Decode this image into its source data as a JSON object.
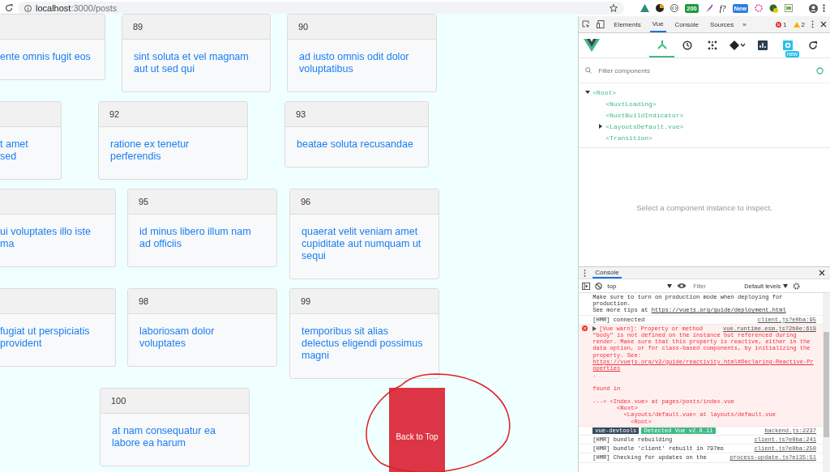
{
  "browser": {
    "host": "localhost",
    "path": ":3000/posts",
    "extensions": [
      {
        "kind": "triangle"
      },
      {
        "kind": "disc"
      },
      {
        "kind": "brackets"
      },
      {
        "kind": "badge",
        "label": "200",
        "color": "#1e9b3c"
      },
      {
        "kind": "feather"
      },
      {
        "kind": "glyph",
        "label": "f?"
      },
      {
        "kind": "badge",
        "label": "New",
        "color": "#2f7de1"
      },
      {
        "kind": "flower"
      },
      {
        "kind": "globe"
      },
      {
        "kind": "sheet"
      }
    ]
  },
  "posts": {
    "rows": [
      {
        "cards": [
          {
            "title": "ente omnis fugit eos"
          },
          {
            "number": "89",
            "title": "sint soluta et vel magnam aut ut sed qui"
          },
          {
            "number": "90",
            "title": "ad iusto omnis odit dolor voluptatibus"
          }
        ]
      },
      {
        "cards": [
          {
            "title": "t amet sed"
          },
          {
            "number": "92",
            "title": "ratione ex tenetur perferendis"
          },
          {
            "number": "93",
            "title": "beatae soluta recusandae"
          }
        ]
      },
      {
        "cards": [
          {
            "title": "ui voluptates illo iste ma"
          },
          {
            "number": "95",
            "title": "id minus libero illum nam ad officiis"
          },
          {
            "number": "96",
            "title": "quaerat velit veniam amet cupiditate aut numquam ut sequi"
          }
        ]
      },
      {
        "cards": [
          {
            "title": "fugiat ut perspiciatis provident"
          },
          {
            "number": "98",
            "title": "laboriosam dolor voluptates"
          },
          {
            "number": "99",
            "title": "temporibus sit alias delectus eligendi possimus magni"
          }
        ]
      },
      {
        "cards": [
          {
            "number": "100",
            "title": "at nam consequatur ea labore ea harum"
          }
        ]
      }
    ],
    "back_to_top": {
      "label": "Back to Top"
    }
  },
  "devtools": {
    "tabs": [
      {
        "label": "Elements",
        "selected": false
      },
      {
        "label": "Vue",
        "selected": true
      },
      {
        "label": "Console",
        "selected": false
      },
      {
        "label": "Sources",
        "selected": false
      }
    ],
    "more": "»",
    "errors": "1",
    "warnings": "2",
    "vue_tools": [
      {
        "kind": "components",
        "selected": true
      },
      {
        "kind": "history",
        "selected": false
      },
      {
        "kind": "vuex",
        "selected": false
      },
      {
        "kind": "routing",
        "selected": false
      },
      {
        "kind": "performance",
        "selected": false
      },
      {
        "kind": "settings",
        "selected": false,
        "badge": "new"
      },
      {
        "kind": "refresh",
        "selected": false
      }
    ],
    "filter": {
      "placeholder": "Filter components"
    },
    "tree": [
      {
        "name": "<Root>",
        "expanded": true,
        "children": [
          {
            "name": "<NuxtLoading>"
          },
          {
            "name": "<NuxtBuildIndicator>"
          },
          {
            "name": "<LayoutsDefault.vue>",
            "expanded": false
          },
          {
            "name": "<Transition>"
          }
        ]
      }
    ],
    "hint": "Select a component instance to inspect."
  },
  "console": {
    "tab": "Console",
    "context": "top",
    "filter": {
      "placeholder": "Filter"
    },
    "levels": "Default levels",
    "messages": [
      {
        "kind": "log",
        "text": "Make sure to turn on production mode when deploying for production.\nSee more tips at ",
        "link": "https://vuejs.org/guide/deployment.html"
      },
      {
        "kind": "log",
        "text": "[HMR] connected",
        "source": "client.js?e0ba:95"
      },
      {
        "kind": "error",
        "head": "[Vue warn]: Property or method",
        "text": "\"body\" is not defined on the instance but referenced during render. Make sure that this property is reactive, either in the data option, or for class-based components, by initializing the property. See: ",
        "link": "https://vuejs.org/v2/guide/reactivity.html#Declaring-Reactive-Properties",
        "after": ".\n\nfound in\n\n---> <Index.vue> at pages/posts/index.vue\n       <Nuxt>\n         <Layouts/default.vue> at layouts/default.vue\n           <Root>",
        "source": "vue.runtime.esm.js?2b0e:619"
      },
      {
        "kind": "badges",
        "badges": [
          "vue-devtools",
          "Detected Vue v2.6.11"
        ],
        "source": "backend.js:2237"
      },
      {
        "kind": "log",
        "text": "[HMR] bundle rebuilding",
        "source": "client.js?e0ba:241"
      },
      {
        "kind": "log",
        "text": "[HMR] bundle 'client' rebuilt in 797ms",
        "source": "client.js?e0ba:250"
      },
      {
        "kind": "log",
        "text": "[HMR] Checking for updates on the",
        "source": "process-update.js?e135:51"
      }
    ]
  }
}
